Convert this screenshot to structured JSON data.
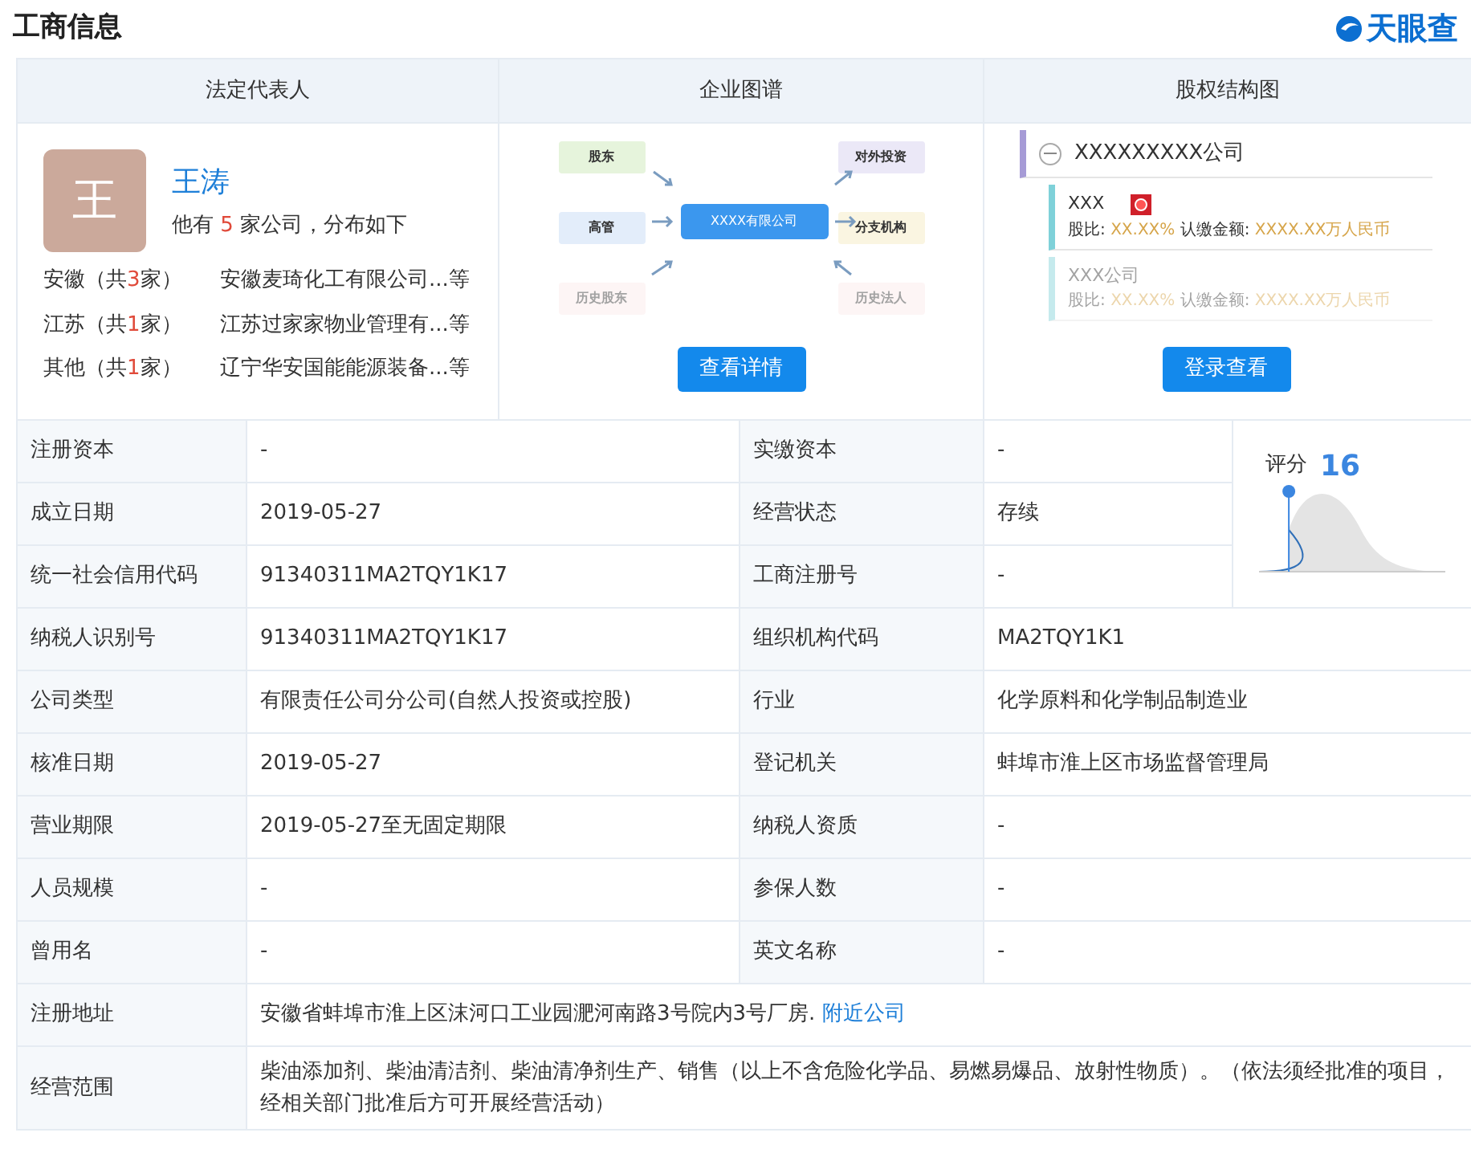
{
  "title": "工商信息",
  "logo": {
    "text": "天眼查"
  },
  "panels": [
    {
      "title": "法定代表人"
    },
    {
      "title": "企业图谱"
    },
    {
      "title": "股权结构图"
    }
  ],
  "legal_rep": {
    "avatar_char": "王",
    "name": "王涛",
    "summary_prefix": "他有",
    "summary_count": "5",
    "summary_suffix": "家公司，分布如下",
    "regions": [
      {
        "prefix": "安徽（共",
        "count": "3",
        "suffix": "家）",
        "companies": "安徽麦琦化工有限公司...等"
      },
      {
        "prefix": "江苏（共",
        "count": "1",
        "suffix": "家）",
        "companies": "江苏过家家物业管理有...等"
      },
      {
        "prefix": "其他（共",
        "count": "1",
        "suffix": "家）",
        "companies": "辽宁华安国能能源装备...等"
      }
    ]
  },
  "graph": {
    "center": "XXXX有限公司",
    "left_nodes": [
      {
        "label": "股东",
        "color": "#e6f4dc",
        "faded": false
      },
      {
        "label": "高管",
        "color": "#e3edfa",
        "faded": false
      },
      {
        "label": "历史股东",
        "color": "#fbeaea",
        "faded": true
      }
    ],
    "right_nodes": [
      {
        "label": "对外投资",
        "color": "#ebe8f7",
        "faded": false
      },
      {
        "label": "分支机构",
        "color": "#faf5e1",
        "faded": false
      },
      {
        "label": "历史法人",
        "color": "#fbeaea",
        "faded": true
      }
    ],
    "button": "查看详情"
  },
  "equity": {
    "root": "XXXXXXXXX公司",
    "expanded": true,
    "holders": [
      {
        "name": "XXX",
        "marked": true,
        "faded": false,
        "ratio_label": "股比:",
        "ratio": "XX.XX%",
        "amount_label": "认缴金额:",
        "amount": "XXXX.XX万人民币"
      },
      {
        "name": "XXX公司",
        "marked": false,
        "faded": true,
        "ratio_label": "股比:",
        "ratio": "XX.XX%",
        "amount_label": "认缴金额:",
        "amount": "XXXX.XX万人民币"
      }
    ],
    "button": "登录查看"
  },
  "score": {
    "label": "评分",
    "value": "16",
    "level": 0.16
  },
  "rows": [
    [
      {
        "label": "注册资本",
        "value": "-"
      },
      {
        "label": "实缴资本",
        "value": "-"
      }
    ],
    [
      {
        "label": "成立日期",
        "value": "2019-05-27"
      },
      {
        "label": "经营状态",
        "value": "存续"
      }
    ],
    [
      {
        "label": "统一社会信用代码",
        "value": "91340311MA2TQY1K17"
      },
      {
        "label": "工商注册号",
        "value": "-"
      }
    ],
    [
      {
        "label": "纳税人识别号",
        "value": "91340311MA2TQY1K17"
      },
      {
        "label": "组织机构代码",
        "value": "MA2TQY1K1"
      }
    ],
    [
      {
        "label": "公司类型",
        "value": "有限责任公司分公司(自然人投资或控股)"
      },
      {
        "label": "行业",
        "value": "化学原料和化学制品制造业"
      }
    ],
    [
      {
        "label": "核准日期",
        "value": "2019-05-27"
      },
      {
        "label": "登记机关",
        "value": "蚌埠市淮上区市场监督管理局"
      }
    ],
    [
      {
        "label": "营业期限",
        "value": "2019-05-27至无固定期限"
      },
      {
        "label": "纳税人资质",
        "value": "-"
      }
    ],
    [
      {
        "label": "人员规模",
        "value": "-"
      },
      {
        "label": "参保人数",
        "value": "-"
      }
    ],
    [
      {
        "label": "曾用名",
        "value": "-"
      },
      {
        "label": "英文名称",
        "value": "-"
      }
    ]
  ],
  "address": {
    "label": "注册地址",
    "value": "安徽省蚌埠市淮上区沫河口工业园淝河南路3号院内3号厂房.",
    "link": "附近公司"
  },
  "scope": {
    "label": "经营范围",
    "value": "柴油添加剂、柴油清洁剂、柴油清净剂生产、销售（以上不含危险化学品、易燃易爆品、放射性物质）。（依法须经批准的项目，经相关部门批准后方可开展经营活动）"
  }
}
